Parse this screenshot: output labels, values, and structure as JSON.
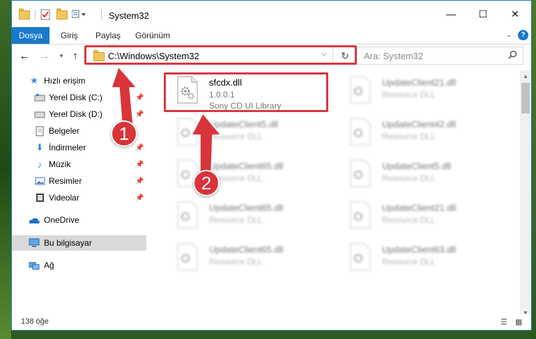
{
  "titlebar": {
    "title": "System32",
    "minimize": "—",
    "maximize": "☐",
    "close": "✕"
  },
  "ribbon": {
    "tabs": [
      "Dosya",
      "Giriş",
      "Paylaş",
      "Görünüm"
    ],
    "help": "?"
  },
  "address": {
    "path": "C:\\Windows\\System32",
    "search_placeholder": "Ara: System32"
  },
  "navpane": {
    "items": [
      {
        "label": "Hızlı erişim",
        "icon": "star-icon"
      },
      {
        "label": "Yerel Disk (C:)",
        "icon": "drive-icon",
        "pinned": true
      },
      {
        "label": "Yerel Disk (D:)",
        "icon": "drive-icon",
        "pinned": true
      },
      {
        "label": "Belgeler",
        "icon": "documents-icon",
        "pinned": true
      },
      {
        "label": "İndirmeler",
        "icon": "download-icon",
        "pinned": true
      },
      {
        "label": "Müzik",
        "icon": "music-icon",
        "pinned": true
      },
      {
        "label": "Resimler",
        "icon": "pictures-icon",
        "pinned": true
      },
      {
        "label": "Videolar",
        "icon": "videos-icon",
        "pinned": true
      },
      {
        "label": "OneDrive",
        "icon": "onedrive-icon"
      },
      {
        "label": "Bu bilgisayar",
        "icon": "computer-icon",
        "selected": true
      },
      {
        "label": "Ağ",
        "icon": "network-icon"
      }
    ]
  },
  "files": {
    "highlighted": {
      "name": "sfcdx.dll",
      "version": "1.0.0.1",
      "description": "Sony CD UI Library"
    },
    "left": [
      {
        "name": "UpdateClient5.dll",
        "type": "Resource DLL"
      },
      {
        "name": "UpdateClient65.dll",
        "type": "Resource DLL"
      },
      {
        "name": "UpdateClient65.dll",
        "type": "Resource DLL"
      },
      {
        "name": "UpdateClient65.dll",
        "type": "Resource DLL"
      }
    ],
    "right": [
      {
        "name": "UpdateClient21.dll",
        "type": "Resource DLL"
      },
      {
        "name": "UpdateClient42.dll",
        "type": "Resource DLL"
      },
      {
        "name": "UpdateClient5.dll",
        "type": "Resource DLL"
      },
      {
        "name": "UpdateClient21.dll",
        "type": "Resource DLL"
      },
      {
        "name": "UpdateClient63.dll",
        "type": "Resource DLL"
      }
    ]
  },
  "status": {
    "count": "138 öğe"
  },
  "annotations": {
    "step1": "1",
    "step2": "2",
    "color": "#d8343a"
  }
}
